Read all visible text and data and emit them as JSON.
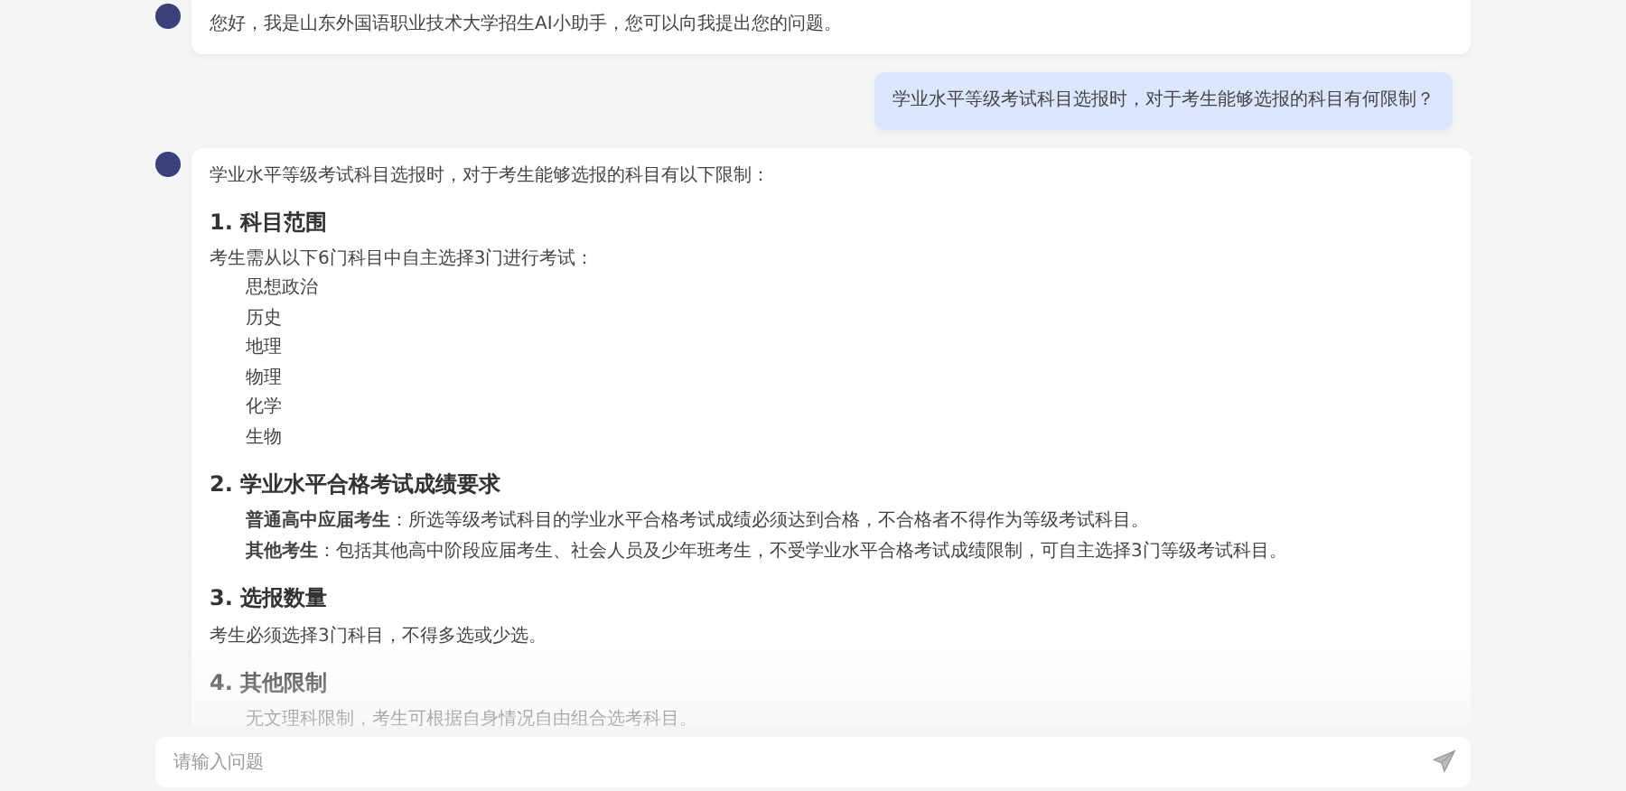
{
  "messages": [
    {
      "kind": "assistant",
      "blocks": [
        {
          "kind": "paragraph",
          "text": "您好，我是山东外国语职业技术大学招生AI小助手，您可以向我提出您的问题。"
        }
      ]
    },
    {
      "kind": "user",
      "blocks": [
        {
          "kind": "paragraph",
          "text": "学业水平等级考试科目选报时，对于考生能够选报的科目有何限制？"
        }
      ]
    },
    {
      "kind": "assistant",
      "blocks": [
        {
          "kind": "paragraph",
          "text": "学业水平等级考试科目选报时，对于考生能够选报的科目有以下限制："
        },
        {
          "kind": "heading",
          "text": "1. 科目范围"
        },
        {
          "kind": "paragraph",
          "text": "考生需从以下6门科目中自主选择3门进行考试："
        },
        {
          "kind": "list",
          "items": [
            "思想政治",
            "历史",
            "地理",
            "物理",
            "化学",
            "生物"
          ]
        },
        {
          "kind": "heading",
          "text": "2. 学业水平合格考试成绩要求"
        },
        {
          "kind": "list",
          "items": [
            "**普通高中应届考生**：所选等级考试科目的学业水平合格考试成绩必须达到合格，不合格者不得作为等级考试科目。",
            "**其他考生**：包括其他高中阶段应届考生、社会人员及少年班考生，不受学业水平合格考试成绩限制，可自主选择3门等级考试科目。"
          ]
        },
        {
          "kind": "heading",
          "text": "3. 选报数量"
        },
        {
          "kind": "paragraph",
          "text": "考生必须选择3门科目，不得多选或少选。"
        },
        {
          "kind": "heading",
          "text": "4. 其他限制"
        },
        {
          "kind": "list",
          "items": [
            "无文理科限制，考生可根据自身情况自由组合选考科目。"
          ]
        }
      ]
    }
  ],
  "input": {
    "placeholder": "请输入问题"
  }
}
